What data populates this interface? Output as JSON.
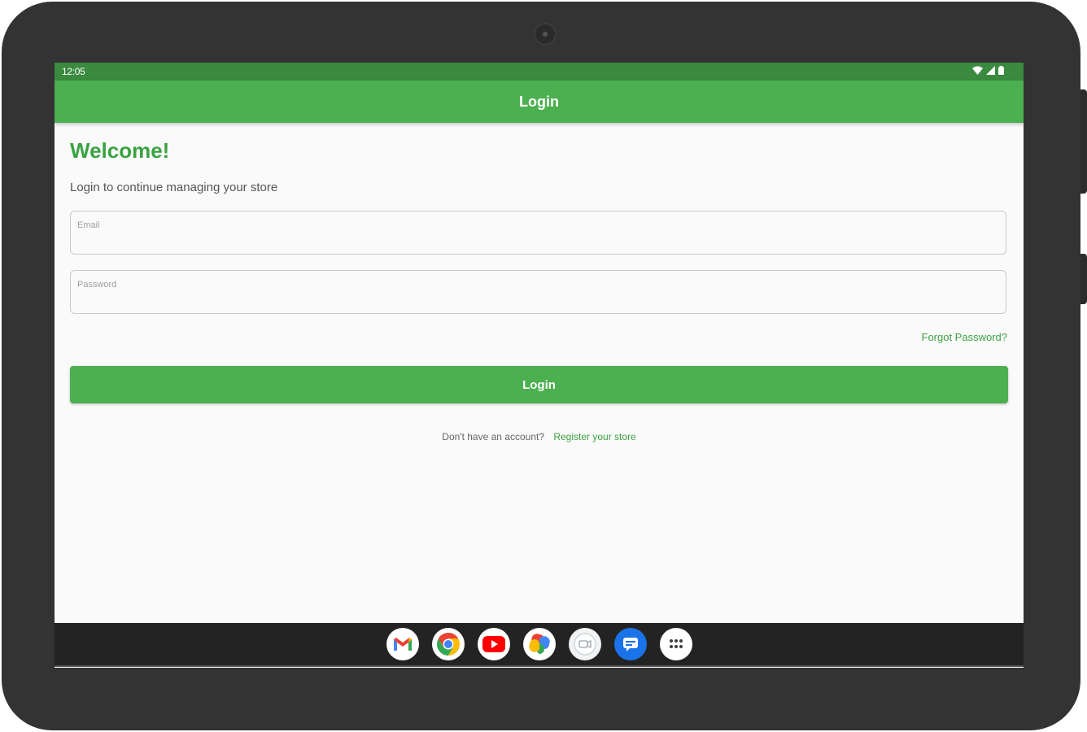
{
  "status_bar": {
    "time": "12:05"
  },
  "app_bar": {
    "title": "Login"
  },
  "login_form": {
    "welcome": "Welcome!",
    "subtitle": "Login to continue managing your store",
    "email_placeholder": "Email",
    "password_placeholder": "Password",
    "forgot_password": "Forgot Password?",
    "login_button": "Login",
    "register_prompt": "Don't have an account?",
    "register_link": "Register your store"
  },
  "dock": {
    "apps": [
      "gmail",
      "chrome",
      "youtube",
      "photos",
      "meet",
      "messages",
      "app-drawer"
    ]
  },
  "colors": {
    "primary": "#4caf50",
    "status_bar": "#3a8a3f",
    "accent_text": "#3aa241",
    "device_frame": "#333333"
  }
}
